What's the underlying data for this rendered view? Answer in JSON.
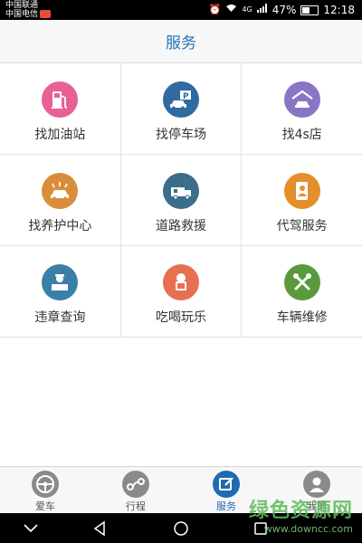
{
  "status_bar": {
    "carrier_1": "中国联通",
    "carrier_2": "中国电信",
    "network_label": "4G",
    "battery_percent": "47%",
    "time": "12:18"
  },
  "header": {
    "title": "服务"
  },
  "services": [
    {
      "label": "找加油站",
      "icon": "gas-station-icon",
      "color": "#ea5f95"
    },
    {
      "label": "找停车场",
      "icon": "parking-icon",
      "color": "#2f6aa1"
    },
    {
      "label": "找4s店",
      "icon": "car-dealer-icon",
      "color": "#8a74c5"
    },
    {
      "label": "找养护中心",
      "icon": "car-wash-icon",
      "color": "#d98d3a"
    },
    {
      "label": "道路救援",
      "icon": "tow-truck-icon",
      "color": "#3c6d8a"
    },
    {
      "label": "代驾服务",
      "icon": "driver-icon",
      "color": "#e58f2a"
    },
    {
      "label": "违章查询",
      "icon": "traffic-police-icon",
      "color": "#3a7fa8"
    },
    {
      "label": "吃喝玩乐",
      "icon": "drink-icon",
      "color": "#e57052"
    },
    {
      "label": "车辆维修",
      "icon": "repair-tools-icon",
      "color": "#5a9a3c"
    }
  ],
  "tabs": [
    {
      "label": "爱车",
      "icon": "steering-wheel-icon",
      "active": false
    },
    {
      "label": "行程",
      "icon": "route-icon",
      "active": false
    },
    {
      "label": "服务",
      "icon": "edit-icon",
      "active": true
    },
    {
      "label": "我的",
      "icon": "user-icon",
      "active": false
    }
  ],
  "colors": {
    "accent": "#2472b8",
    "tab_active": "#1e6bb0",
    "tab_inactive": "#8a8a8a"
  },
  "watermark": {
    "text": "绿色资源网",
    "url": "www.downcc.com"
  }
}
